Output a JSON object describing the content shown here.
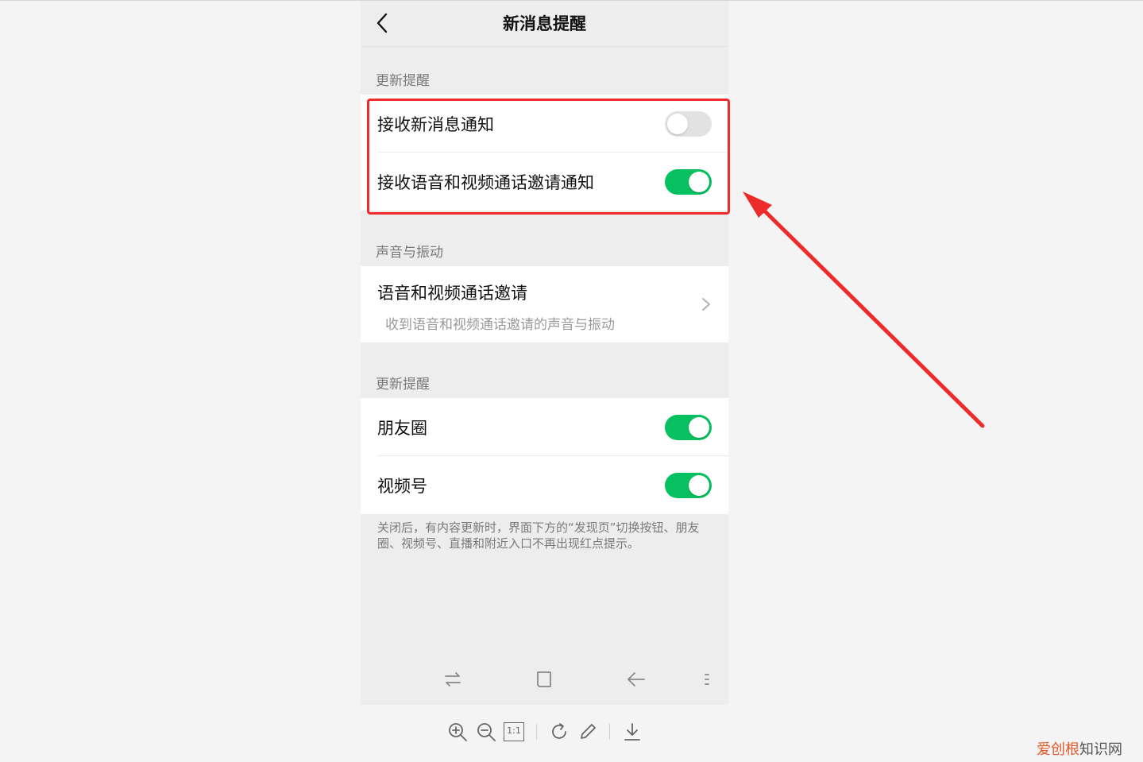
{
  "nav": {
    "title": "新消息提醒"
  },
  "sections": [
    {
      "label": "更新提醒"
    },
    {
      "label": "声音与振动"
    },
    {
      "label": "更新提醒"
    }
  ],
  "notify_group": [
    {
      "label": "接收新消息通知",
      "enabled": false
    },
    {
      "label": "接收语音和视频通话邀请通知",
      "enabled": true
    }
  ],
  "sound_item": {
    "title": "语音和视频通话邀请",
    "desc": "收到语音和视频通话邀请的声音与振动"
  },
  "update_group": [
    {
      "label": "朋友圈",
      "enabled": true
    },
    {
      "label": "视频号",
      "enabled": true
    }
  ],
  "footnote": "关闭后，有内容更新时，界面下方的“发现页”切换按钮、朋友圈、视频号、直播和附近入口不再出现红点提示。",
  "viewer": {
    "actual_size_label": "1:1"
  },
  "watermark": {
    "part1": "爱创根",
    "part2": "知识网"
  },
  "colors": {
    "toggle_on": "#07c160",
    "toggle_off": "#e2e2e2",
    "highlight": "#ef2b2b"
  }
}
